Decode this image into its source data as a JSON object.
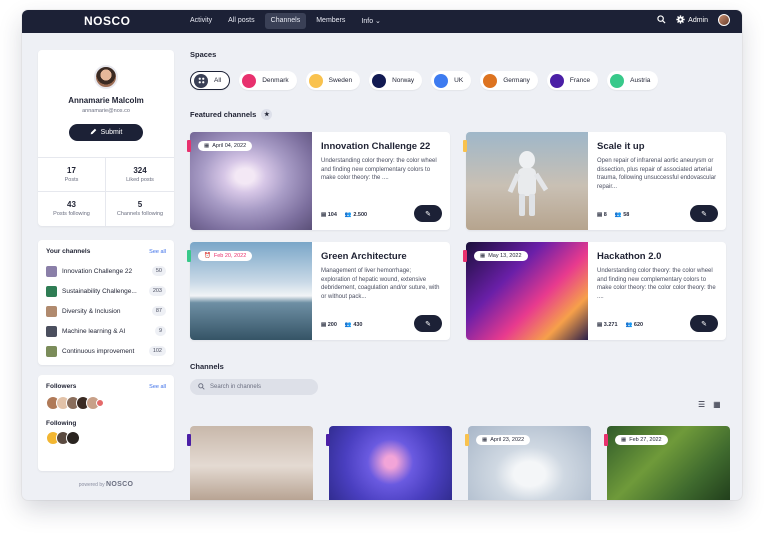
{
  "app": {
    "logo": "NOSCO"
  },
  "nav": {
    "items": [
      "Activity",
      "All posts",
      "Channels",
      "Members",
      "Info ⌄"
    ],
    "active_index": 2,
    "admin_label": "Admin"
  },
  "profile": {
    "name": "Annamarie Malcolm",
    "email": "annamarie@nos.co",
    "submit_label": "Submit",
    "stats": [
      {
        "value": "17",
        "label": "Posts"
      },
      {
        "value": "324",
        "label": "Liked posts"
      },
      {
        "value": "43",
        "label": "Posts following"
      },
      {
        "value": "5",
        "label": "Channels following"
      }
    ]
  },
  "your_channels": {
    "title": "Your channels",
    "see_all": "See all",
    "items": [
      {
        "label": "Innovation Challenge 22",
        "count": "50",
        "color": "#8a7fa8"
      },
      {
        "label": "Sustainability Challenge...",
        "count": "203",
        "color": "#2f7d54"
      },
      {
        "label": "Diversity & Inclusion",
        "count": "87",
        "color": "#b08a6e"
      },
      {
        "label": "Machine learning & AI",
        "count": "9",
        "color": "#4b4f5e"
      },
      {
        "label": "Continuous improvement",
        "count": "102",
        "color": "#7b8c5a"
      }
    ]
  },
  "followers": {
    "title": "Followers",
    "see_all": "See all",
    "following_title": "Following"
  },
  "powered": {
    "prefix": "powered by",
    "brand": "NOSCO"
  },
  "spaces": {
    "title": "Spaces",
    "items": [
      {
        "label": "All",
        "color": "#3a4056"
      },
      {
        "label": "Denmark",
        "color": "#e8316e"
      },
      {
        "label": "Sweden",
        "color": "#f9c24e"
      },
      {
        "label": "Norway",
        "color": "#121a52"
      },
      {
        "label": "UK",
        "color": "#3d7bf0"
      },
      {
        "label": "Germany",
        "color": "#dd7320"
      },
      {
        "label": "France",
        "color": "#4b1fa6"
      },
      {
        "label": "Austria",
        "color": "#38c98a"
      }
    ]
  },
  "featured": {
    "title": "Featured channels",
    "cards": [
      {
        "title": "Innovation Challenge 22",
        "date": "April 04, 2022",
        "desc": "Understanding color theory: the color wheel and finding new complementary colors to make color theory: the ....",
        "posts": "104",
        "members": "2.500",
        "flag": "#e8316e"
      },
      {
        "title": "Scale it up",
        "date": "",
        "desc": "Open repair of infrarenal aortic aneurysm or dissection, plus repair of associated arterial trauma, following unsuccessful endovascular repair...",
        "posts": "8",
        "members": "58",
        "flag": "#f9c24e"
      },
      {
        "title": "Green Architecture",
        "date": "Feb 20, 2022",
        "desc": "Management of liver hemorrhage; exploration of hepatic wound, extensive debridement, coagulation and/or suture, with or without pack...",
        "posts": "200",
        "members": "430",
        "flag": "#38c98a"
      },
      {
        "title": "Hackathon 2.0",
        "date": "May 13, 2022",
        "desc": "Understanding color theory: the color wheel and finding new complementary colors to make color theory: the color color theory: the ....",
        "posts": "3.271",
        "members": "620",
        "flag": "#e8316e"
      }
    ]
  },
  "channels": {
    "title": "Channels",
    "search_placeholder": "Search in channels",
    "cards": [
      {
        "date": "",
        "flag": "#4b1fa6"
      },
      {
        "date": "",
        "flag": "#4b1fa6"
      },
      {
        "date": "April 23, 2022",
        "flag": "#f9c24e"
      },
      {
        "date": "Feb 27, 2022",
        "flag": "#e8316e"
      }
    ]
  }
}
